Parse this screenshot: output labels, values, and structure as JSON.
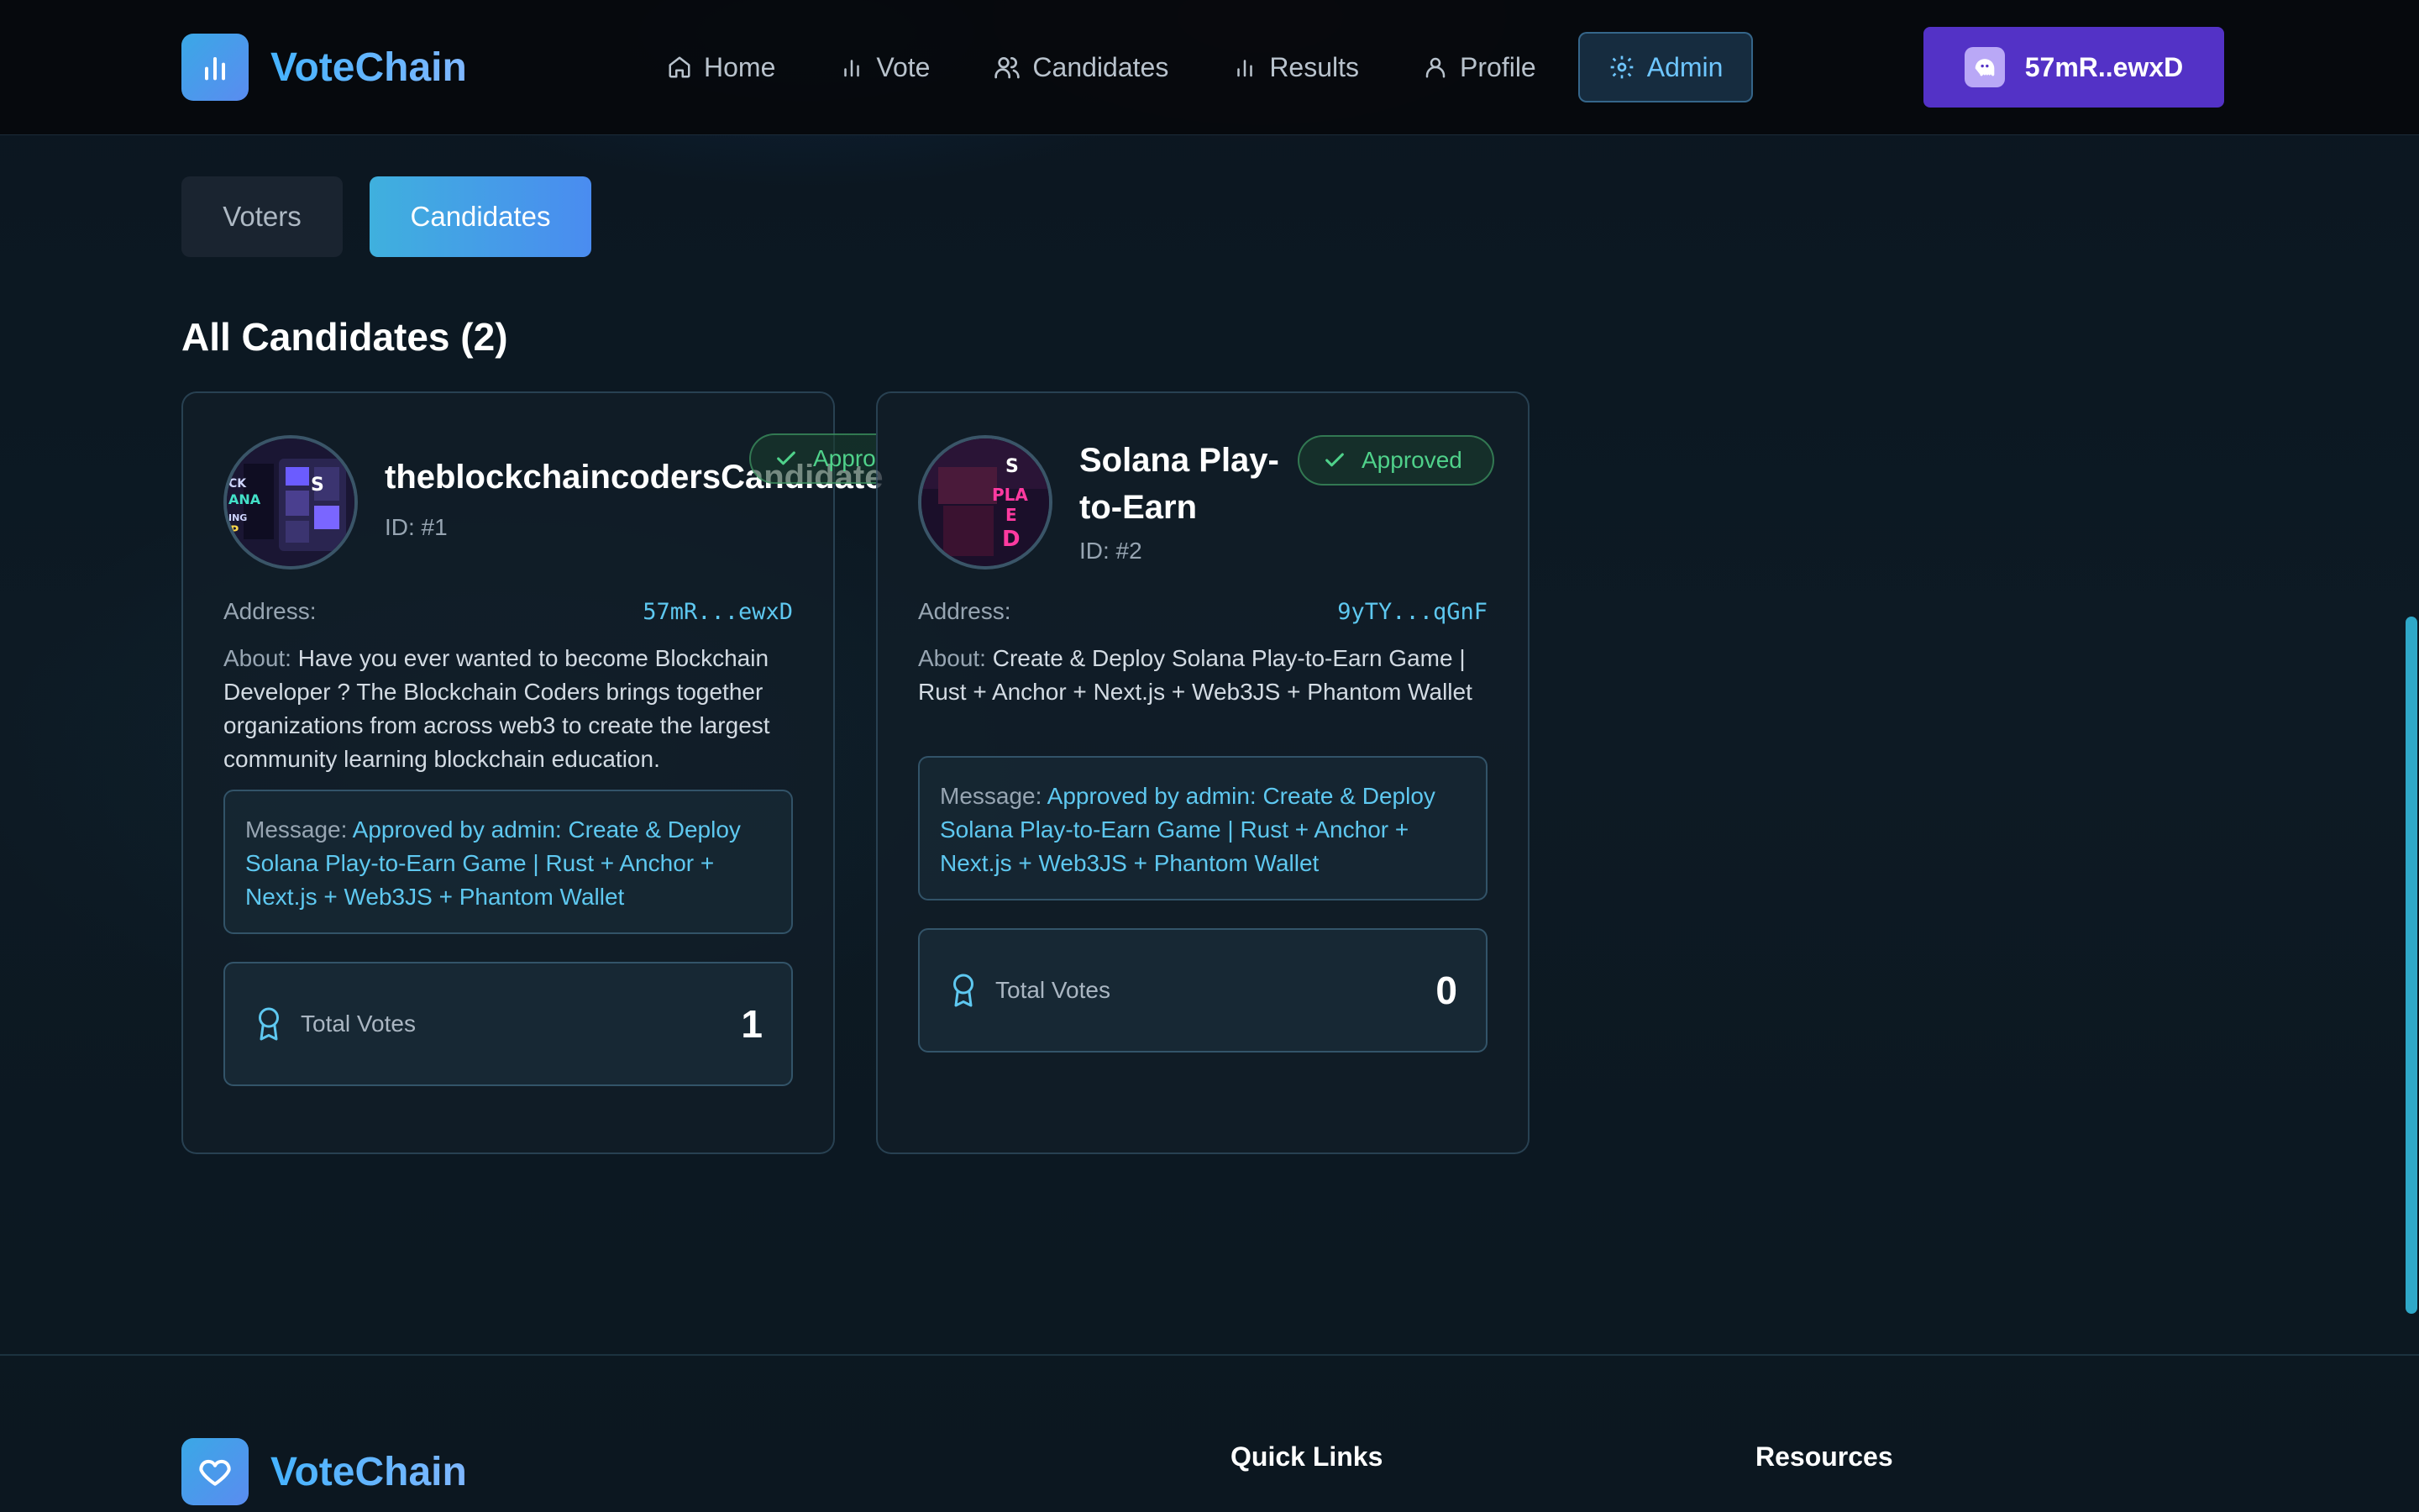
{
  "app": {
    "name": "VoteChain"
  },
  "nav": {
    "items": [
      {
        "label": "Home",
        "icon": "home-icon"
      },
      {
        "label": "Vote",
        "icon": "bar-chart-icon"
      },
      {
        "label": "Candidates",
        "icon": "users-icon"
      },
      {
        "label": "Results",
        "icon": "bar-chart-icon"
      },
      {
        "label": "Profile",
        "icon": "user-icon"
      },
      {
        "label": "Admin",
        "icon": "gear-icon",
        "active": true
      }
    ]
  },
  "wallet": {
    "label": "57mR..ewxD",
    "icon": "phantom-ghost-icon",
    "color": "#5332c6"
  },
  "tabs": {
    "voters": "Voters",
    "candidates": "Candidates",
    "active": "Candidates"
  },
  "section": {
    "title": "All Candidates (2)"
  },
  "labels": {
    "address": "Address:",
    "about": "About:",
    "message": "Message:",
    "total_votes": "Total Votes"
  },
  "candidates": [
    {
      "name": "theblockchaincodersCandidate",
      "id": "ID: #1",
      "status": "Approved",
      "address": "57mR...ewxD",
      "about": "Have you ever wanted to become Blockchain Developer ? The Blockchain Coders brings together organizations from across web3 to create the largest community learning blockchain education.",
      "message": "Approved by admin: Create & Deploy Solana Play-to-Earn Game | Rust + Anchor + Next.js + Web3JS + Phantom Wallet",
      "votes": "1"
    },
    {
      "name": "Solana Play-to-Earn",
      "id": "ID: #2",
      "status": "Approved",
      "address": "9yTY...qGnF",
      "about": "Create & Deploy Solana Play-to-Earn Game | Rust + Anchor + Next.js + Web3JS + Phantom Wallet",
      "message": "Approved by admin: Create & Deploy Solana Play-to-Earn Game | Rust + Anchor + Next.js + Web3JS + Phantom Wallet",
      "votes": "0"
    }
  ],
  "footer": {
    "brand": "VoteChain",
    "quick_links": "Quick Links",
    "resources": "Resources"
  },
  "colors": {
    "accent": "#45b3ff",
    "approved": "#4fd18a",
    "link": "#5ec8f0"
  }
}
